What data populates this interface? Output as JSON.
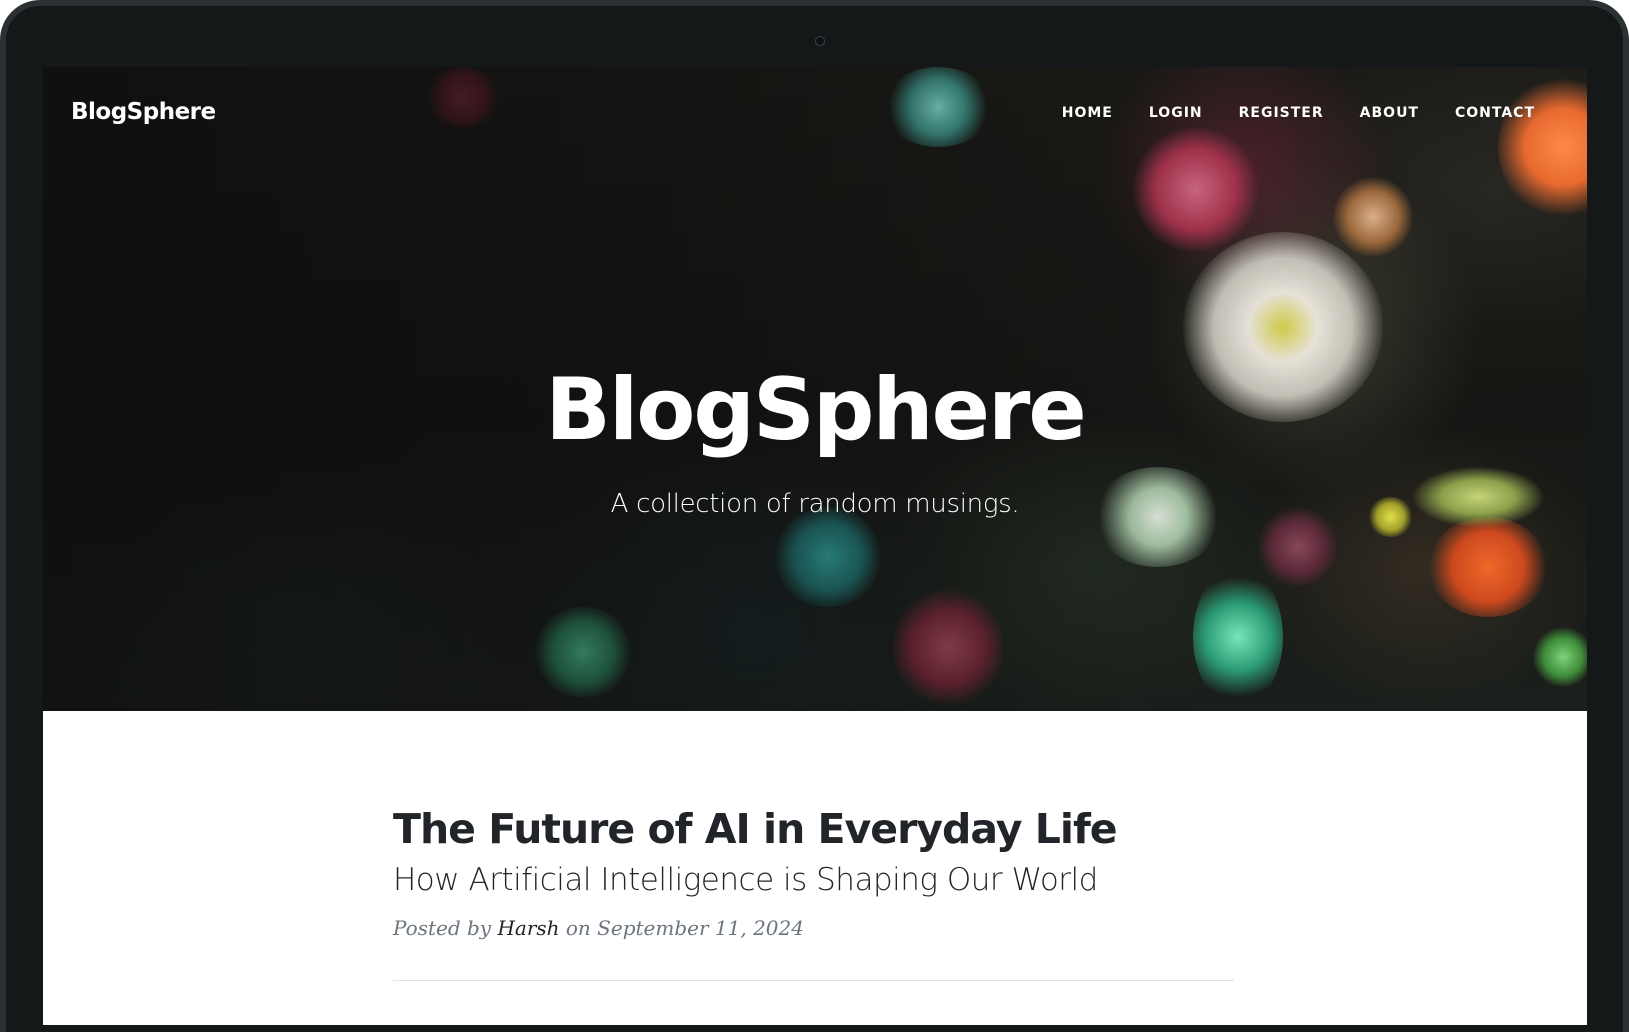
{
  "site": {
    "brand": "BlogSphere"
  },
  "nav": {
    "items": [
      {
        "label": "HOME"
      },
      {
        "label": "LOGIN"
      },
      {
        "label": "REGISTER"
      },
      {
        "label": "ABOUT"
      },
      {
        "label": "CONTACT"
      }
    ]
  },
  "hero": {
    "title": "BlogSphere",
    "subtitle": "A collection of random musings."
  },
  "post": {
    "title": "The Future of AI in Everyday Life",
    "subtitle": "How Artificial Intelligence is Shaping Our World",
    "meta_prefix": "Posted by",
    "author": "Harsh",
    "meta_on": "on",
    "date": "September 11, 2024"
  },
  "colors": {
    "text_dark": "#212529",
    "text_muted": "#6c757d",
    "divider": "#dee2e6",
    "frame": "#141819"
  }
}
